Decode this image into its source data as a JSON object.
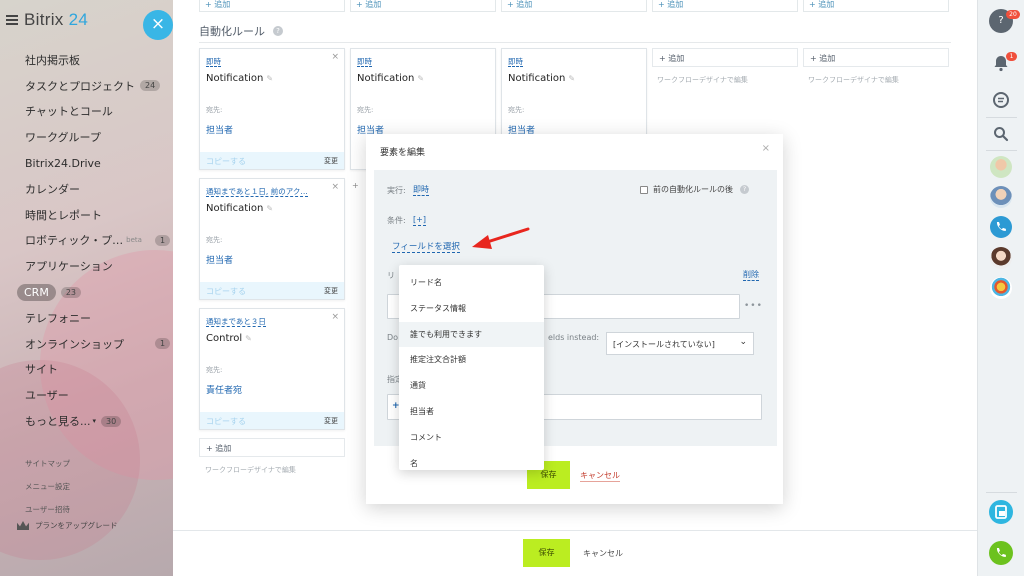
{
  "sidebar": {
    "logo": "Bitrix",
    "logo_num": "24",
    "close": "×",
    "items": [
      {
        "label": "社内掲示板"
      },
      {
        "label": "タスクとプロジェクト",
        "counter": "24"
      },
      {
        "label": "チャットとコール"
      },
      {
        "label": "ワークグループ"
      },
      {
        "label": "Bitrix24.Drive"
      },
      {
        "label": "カレンダー"
      },
      {
        "label": "時間とレポート"
      },
      {
        "label": "ロボティック・プ…",
        "beta": "beta",
        "counter": "1"
      },
      {
        "label": "アプリケーション"
      },
      {
        "label": "CRM",
        "counter": "23"
      },
      {
        "label": "テレフォニー"
      },
      {
        "label": "オンラインショップ",
        "counter": "1"
      },
      {
        "label": "サイト"
      },
      {
        "label": "ユーザー"
      },
      {
        "label": "もっと見る...",
        "counter": "30"
      }
    ],
    "sub_links": [
      "サイトマップ",
      "メニュー設定",
      "ユーザー招待"
    ],
    "upgrade": "プランをアップグレード"
  },
  "main": {
    "top_add": "+ 追加",
    "section_title": "自動化ルール",
    "help": "?",
    "cards": [
      {
        "trigger": "即時",
        "title": "Notification",
        "recipient_label": "宛先:",
        "recipient": "担当者",
        "copy": "コピーする",
        "change": "変更"
      },
      {
        "trigger": "即時",
        "title": "Notification",
        "recipient_label": "宛先:",
        "recipient": "担当者"
      },
      {
        "trigger": "即時",
        "title": "Notification",
        "recipient_label": "宛先:",
        "recipient": "担当者"
      },
      {
        "trigger": "通知まであと１日, 前のアク…",
        "title": "Notification",
        "recipient_label": "宛先:",
        "recipient": "担当者",
        "copy": "コピーする",
        "change": "変更"
      },
      {
        "trigger": "通知まであと３日",
        "title": "Control",
        "recipient_label": "宛先:",
        "recipient": "責任者宛",
        "copy": "コピーする",
        "change": "変更"
      }
    ],
    "add_label": "+ 追加",
    "designer": "ワークフローデザイナで編集",
    "save": "保存",
    "cancel": "キャンセル"
  },
  "modal": {
    "title": "要素を編集",
    "close": "×",
    "exec_label": "実行:",
    "exec_value": "即時",
    "prev_rule": "前の自動化ルールの後",
    "cond_label": "条件:",
    "cond_add": "[+]",
    "select_field": "フィールドを選択",
    "lead_label": "リ",
    "delete": "削除",
    "do_label": "Do",
    "fields_instead": "elds instead:",
    "select_value": "[インストールされていない]",
    "designated_label": "指定",
    "plus": "+",
    "dots": "•••",
    "save": "保存",
    "cancel": "キャンセル"
  },
  "dropdown": {
    "options": [
      "リード名",
      "ステータス情報",
      "誰でも利用できます",
      "推定注文合計額",
      "通貨",
      "担当者",
      "コメント",
      "名"
    ]
  },
  "rail": {
    "help_badge": "20",
    "bell_badge": "1"
  }
}
